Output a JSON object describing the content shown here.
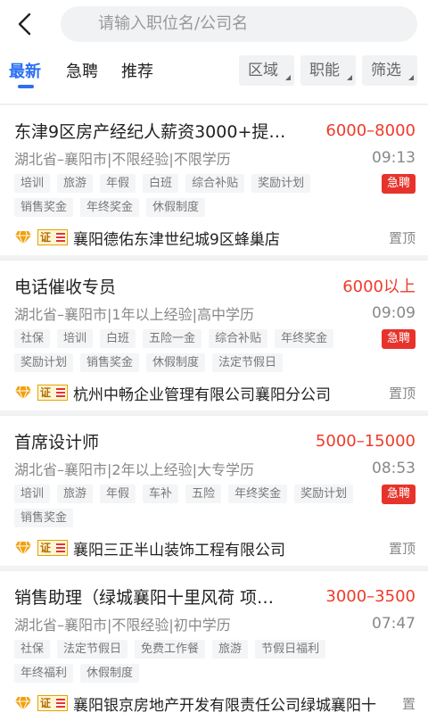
{
  "search": {
    "placeholder": "请输入职位名/公司名"
  },
  "tabs": [
    {
      "label": "最新",
      "active": true
    },
    {
      "label": "急聘"
    },
    {
      "label": "推荐"
    }
  ],
  "filters": [
    "区域",
    "职能",
    "筛选"
  ],
  "jobs": [
    {
      "title": "东津9区房产经纪人薪资3000+提…",
      "salary": "6000–8000",
      "meta": "湖北省–襄阳市|不限经验|不限学历",
      "time": "09:13",
      "tags": [
        "培训",
        "旅游",
        "年假",
        "白班",
        "综合补贴",
        "奖励计划",
        "销售奖金",
        "年终奖金",
        "休假制度"
      ],
      "urgent": "急聘",
      "cert": "证",
      "company": "襄阳德佑东津世纪城9区蜂巢店",
      "pin": "置顶"
    },
    {
      "title": "电话催收专员",
      "salary": "6000以上",
      "meta": "湖北省–襄阳市|1年以上经验|高中学历",
      "time": "09:09",
      "tags": [
        "社保",
        "培训",
        "白班",
        "五险一金",
        "综合补贴",
        "年终奖金",
        "奖励计划",
        "销售奖金",
        "休假制度",
        "法定节假日"
      ],
      "urgent": "急聘",
      "cert": "证",
      "company": "杭州中畅企业管理有限公司襄阳分公司",
      "pin": "置顶"
    },
    {
      "title": "首席设计师",
      "salary": "5000–15000",
      "meta": "湖北省–襄阳市|2年以上经验|大专学历",
      "time": "08:53",
      "tags": [
        "培训",
        "旅游",
        "年假",
        "车补",
        "五险",
        "年终奖金",
        "奖励计划",
        "销售奖金"
      ],
      "urgent": "急聘",
      "cert": "证",
      "company": "襄阳三正半山装饰工程有限公司",
      "pin": "置顶"
    },
    {
      "title": "销售助理（绿城襄阳十里风荷 项…",
      "salary": "3000–3500",
      "meta": "湖北省–襄阳市|不限经验|初中学历",
      "time": "07:47",
      "tags": [
        "社保",
        "法定节假日",
        "免费工作餐",
        "旅游",
        "节假日福利",
        "年终福利",
        "休假制度"
      ],
      "urgent": "",
      "cert": "证",
      "company": "襄阳银京房地产开发有限责任公司绿城襄阳十",
      "pin": "置"
    }
  ]
}
